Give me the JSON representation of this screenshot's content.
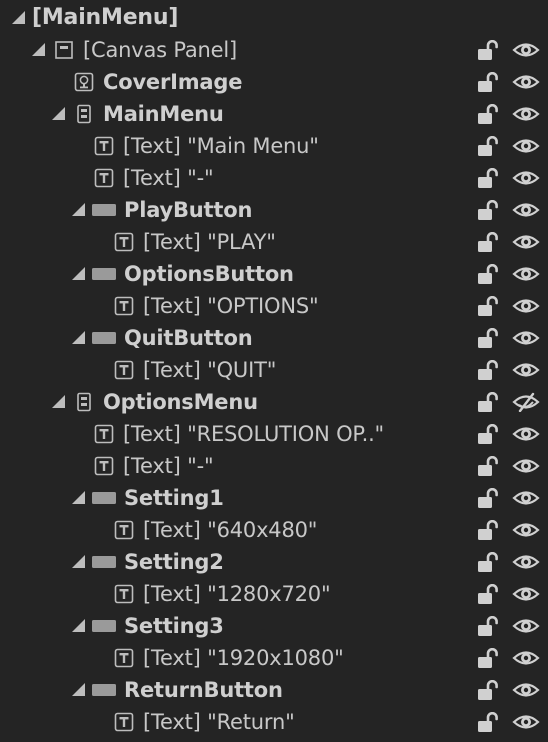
{
  "tree": {
    "rows": [
      {
        "label": "[MainMenu]",
        "icon": "none",
        "level": 0,
        "bold": true,
        "expanded": true,
        "eye": "visible"
      },
      {
        "label": "[Canvas Panel]",
        "icon": "canvas-panel-icon",
        "level": 1,
        "bold": false,
        "expanded": true,
        "eye": "visible"
      },
      {
        "label": "CoverImage",
        "icon": "image-icon",
        "level": 2,
        "bold": true,
        "expanded": null,
        "eye": "visible"
      },
      {
        "label": "MainMenu",
        "icon": "vertical-box-icon",
        "level": 2,
        "bold": true,
        "expanded": true,
        "eye": "visible"
      },
      {
        "label": "[Text] \"Main Menu\"",
        "icon": "text-icon",
        "level": 3,
        "bold": false,
        "expanded": null,
        "eye": "visible"
      },
      {
        "label": "[Text] \"-\"",
        "icon": "text-icon",
        "level": 3,
        "bold": false,
        "expanded": null,
        "eye": "visible"
      },
      {
        "label": "PlayButton",
        "icon": "button-icon",
        "level": 3,
        "bold": true,
        "expanded": true,
        "eye": "visible"
      },
      {
        "label": "[Text] \"PLAY\"",
        "icon": "text-icon",
        "level": 4,
        "bold": false,
        "expanded": null,
        "eye": "visible"
      },
      {
        "label": "OptionsButton",
        "icon": "button-icon",
        "level": 3,
        "bold": true,
        "expanded": true,
        "eye": "visible"
      },
      {
        "label": "[Text] \"OPTIONS\"",
        "icon": "text-icon",
        "level": 4,
        "bold": false,
        "expanded": null,
        "eye": "visible"
      },
      {
        "label": "QuitButton",
        "icon": "button-icon",
        "level": 3,
        "bold": true,
        "expanded": true,
        "eye": "visible"
      },
      {
        "label": "[Text] \"QUIT\"",
        "icon": "text-icon",
        "level": 4,
        "bold": false,
        "expanded": null,
        "eye": "visible"
      },
      {
        "label": "OptionsMenu",
        "icon": "vertical-box-icon",
        "level": 2,
        "bold": true,
        "expanded": true,
        "eye": "hidden"
      },
      {
        "label": "[Text] \"RESOLUTION OP..\"",
        "icon": "text-icon",
        "level": 3,
        "bold": false,
        "expanded": null,
        "eye": "visible"
      },
      {
        "label": "[Text] \"-\"",
        "icon": "text-icon",
        "level": 3,
        "bold": false,
        "expanded": null,
        "eye": "visible"
      },
      {
        "label": "Setting1",
        "icon": "button-icon",
        "level": 3,
        "bold": true,
        "expanded": true,
        "eye": "visible"
      },
      {
        "label": "[Text] \"640x480\"",
        "icon": "text-icon",
        "level": 4,
        "bold": false,
        "expanded": null,
        "eye": "visible"
      },
      {
        "label": "Setting2",
        "icon": "button-icon",
        "level": 3,
        "bold": true,
        "expanded": true,
        "eye": "visible"
      },
      {
        "label": "[Text] \"1280x720\"",
        "icon": "text-icon",
        "level": 4,
        "bold": false,
        "expanded": null,
        "eye": "visible"
      },
      {
        "label": "Setting3",
        "icon": "button-icon",
        "level": 3,
        "bold": true,
        "expanded": true,
        "eye": "visible"
      },
      {
        "label": "[Text] \"1920x1080\"",
        "icon": "text-icon",
        "level": 4,
        "bold": false,
        "expanded": null,
        "eye": "visible"
      },
      {
        "label": "ReturnButton",
        "icon": "button-icon",
        "level": 3,
        "bold": true,
        "expanded": true,
        "eye": "visible"
      },
      {
        "label": "[Text] \"Return\"",
        "icon": "text-icon",
        "level": 4,
        "bold": false,
        "expanded": null,
        "eye": "visible"
      }
    ]
  }
}
